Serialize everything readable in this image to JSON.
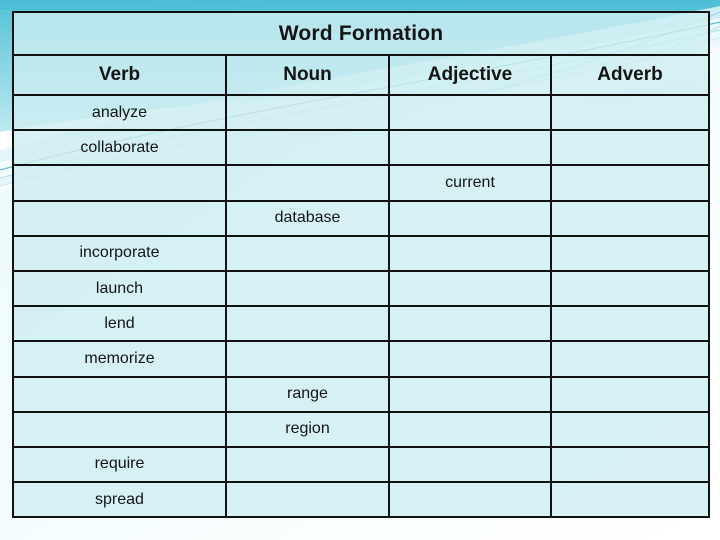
{
  "slide": {
    "title": "Word Formation",
    "background": {
      "base_color": "#fdfdfd",
      "swoosh_dark": "#3fb9cf",
      "swoosh_mid": "#7fd3e2",
      "swoosh_light": "#d7f1f6",
      "band_top_color": "#5ec6dc"
    }
  },
  "table": {
    "cell_fill": "#cdeef1",
    "border_color": "#111111",
    "columns": [
      {
        "key": "verb",
        "label": "Verb"
      },
      {
        "key": "noun",
        "label": "Noun"
      },
      {
        "key": "adjective",
        "label": "Adjective"
      },
      {
        "key": "adverb",
        "label": "Adverb"
      }
    ],
    "rows": [
      {
        "verb": "analyze",
        "noun": "",
        "adjective": "",
        "adverb": ""
      },
      {
        "verb": "collaborate",
        "noun": "",
        "adjective": "",
        "adverb": ""
      },
      {
        "verb": "",
        "noun": "",
        "adjective": "current",
        "adverb": ""
      },
      {
        "verb": "",
        "noun": "database",
        "adjective": "",
        "adverb": ""
      },
      {
        "verb": "incorporate",
        "noun": "",
        "adjective": "",
        "adverb": ""
      },
      {
        "verb": "launch",
        "noun": "",
        "adjective": "",
        "adverb": ""
      },
      {
        "verb": "lend",
        "noun": "",
        "adjective": "",
        "adverb": ""
      },
      {
        "verb": "memorize",
        "noun": "",
        "adjective": "",
        "adverb": ""
      },
      {
        "verb": "",
        "noun": "range",
        "adjective": "",
        "adverb": ""
      },
      {
        "verb": "",
        "noun": "region",
        "adjective": "",
        "adverb": ""
      },
      {
        "verb": "require",
        "noun": "",
        "adjective": "",
        "adverb": ""
      },
      {
        "verb": "spread",
        "noun": "",
        "adjective": "",
        "adverb": ""
      }
    ]
  }
}
